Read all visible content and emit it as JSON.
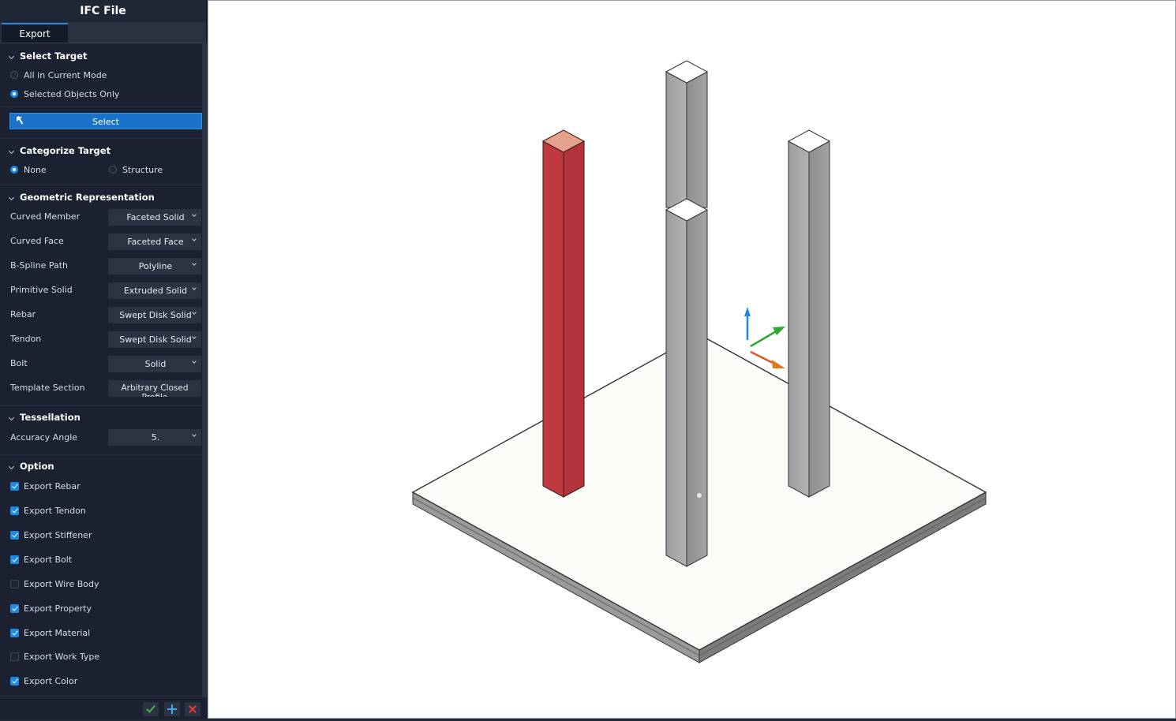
{
  "window": {
    "title": "IFC File"
  },
  "tabs": [
    {
      "label": "Export"
    }
  ],
  "select_target": {
    "heading": "Select Target",
    "options": [
      {
        "label": "All in Current Mode",
        "selected": false
      },
      {
        "label": "Selected Objects Only",
        "selected": true
      }
    ],
    "select_button": "Select"
  },
  "categorize_target": {
    "heading": "Categorize Target",
    "options": [
      {
        "label": "None",
        "selected": true
      },
      {
        "label": "Structure",
        "selected": false
      }
    ]
  },
  "geometric_representation": {
    "heading": "Geometric Representation",
    "fields": [
      {
        "label": "Curved Member",
        "value": "Faceted Solid"
      },
      {
        "label": "Curved Face",
        "value": "Faceted Face"
      },
      {
        "label": "B-Spline Path",
        "value": "Polyline"
      },
      {
        "label": "Primitive Solid",
        "value": "Extruded Solid"
      },
      {
        "label": "Rebar",
        "value": "Swept Disk Solid"
      },
      {
        "label": "Tendon",
        "value": "Swept Disk Solid"
      },
      {
        "label": "Bolt",
        "value": "Solid"
      },
      {
        "label": "Template Section",
        "value": "Arbitrary Closed Profile"
      }
    ]
  },
  "tessellation": {
    "heading": "Tessellation",
    "accuracy_label": "Accuracy Angle",
    "accuracy_value": "5."
  },
  "option": {
    "heading": "Option",
    "items": [
      {
        "label": "Export Rebar",
        "checked": true
      },
      {
        "label": "Export Tendon",
        "checked": true
      },
      {
        "label": "Export Stiffener",
        "checked": true
      },
      {
        "label": "Export Bolt",
        "checked": true
      },
      {
        "label": "Export Wire Body",
        "checked": false
      },
      {
        "label": "Export Property",
        "checked": true
      },
      {
        "label": "Export Material",
        "checked": true
      },
      {
        "label": "Export Work Type",
        "checked": false
      },
      {
        "label": "Export Color",
        "checked": true
      }
    ]
  },
  "footer": {
    "icons": [
      "check-icon",
      "plus-icon",
      "close-icon"
    ]
  },
  "colors": {
    "accent": "#1e88e5",
    "panel_bg": "#1b2131",
    "selected_column": "#c0393e",
    "column_gray": "#a6a6a6",
    "axis_z": "#1e88e5",
    "axis_y": "#2fa82f",
    "axis_x": "#e0542a"
  }
}
